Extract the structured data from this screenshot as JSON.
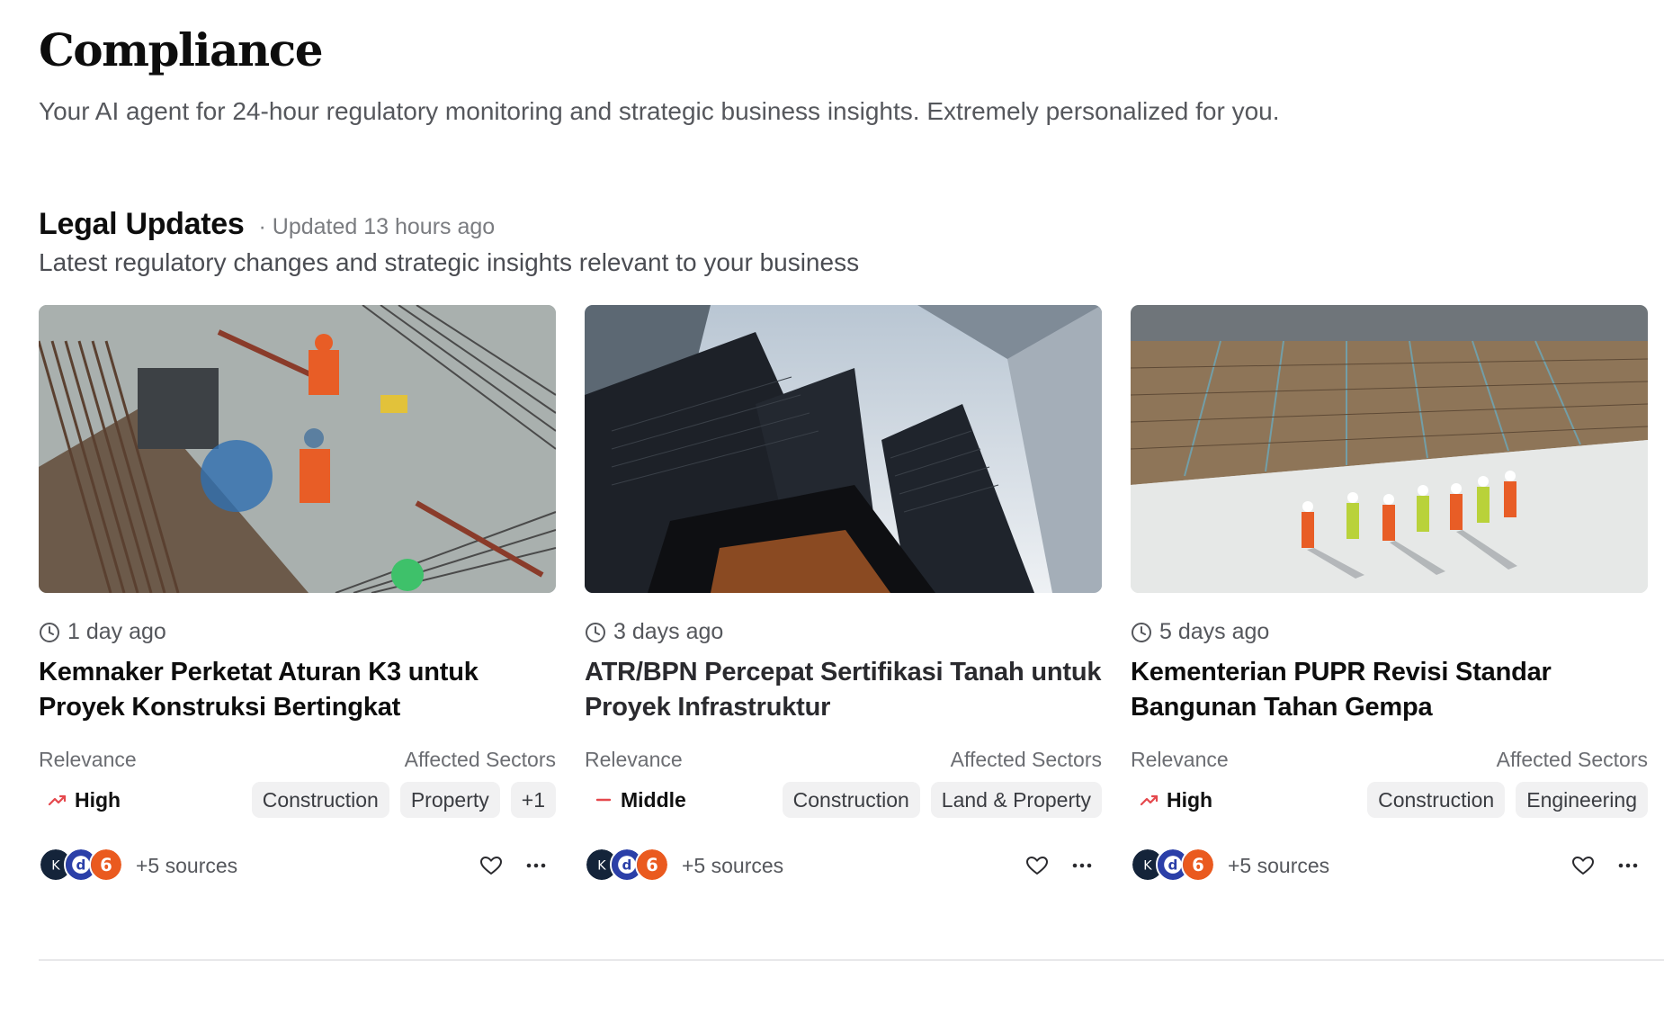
{
  "page": {
    "title": "Compliance",
    "subtitle": "Your AI agent for 24-hour regulatory monitoring and strategic business insights. Extremely personalized for you."
  },
  "section": {
    "title": "Legal Updates",
    "updated": "· Updated 13 hours ago",
    "description": "Latest regulatory changes and strategic insights relevant to your business"
  },
  "labels": {
    "relevance": "Relevance",
    "affected_sectors": "Affected Sectors"
  },
  "cards": [
    {
      "image": "construction-workers-rebar-photo",
      "time": "1 day ago",
      "title": "Kemnaker Perketat Aturan K3 untuk Proyek Konstruksi Bertingkat",
      "relevance": "High",
      "relevance_icon": "trending-up-icon",
      "relevance_color": "#e5484d",
      "tags": [
        "Construction",
        "Property",
        "+1"
      ],
      "sources": "+5 sources"
    },
    {
      "image": "skyscrapers-looking-up-photo",
      "time": "3 days ago",
      "title": "ATR/BPN Percepat Sertifikasi Tanah untuk Proyek Infrastruktur",
      "relevance": "Middle",
      "relevance_icon": "dash-icon",
      "relevance_color": "#e5484d",
      "tags": [
        "Construction",
        "Land & Property"
      ],
      "sources": "+5 sources"
    },
    {
      "image": "construction-site-inspectors-photo",
      "time": "5 days ago",
      "title": "Kementerian PUPR Revisi Standar Bangunan Tahan Gempa",
      "relevance": "High",
      "relevance_icon": "trending-up-icon",
      "relevance_color": "#e5484d",
      "tags": [
        "Construction",
        "Engineering"
      ],
      "sources": "+5 sources"
    }
  ],
  "colors": {
    "accent_red": "#e5484d",
    "tag_bg": "#f1f1f2",
    "text_muted": "#55575c"
  }
}
